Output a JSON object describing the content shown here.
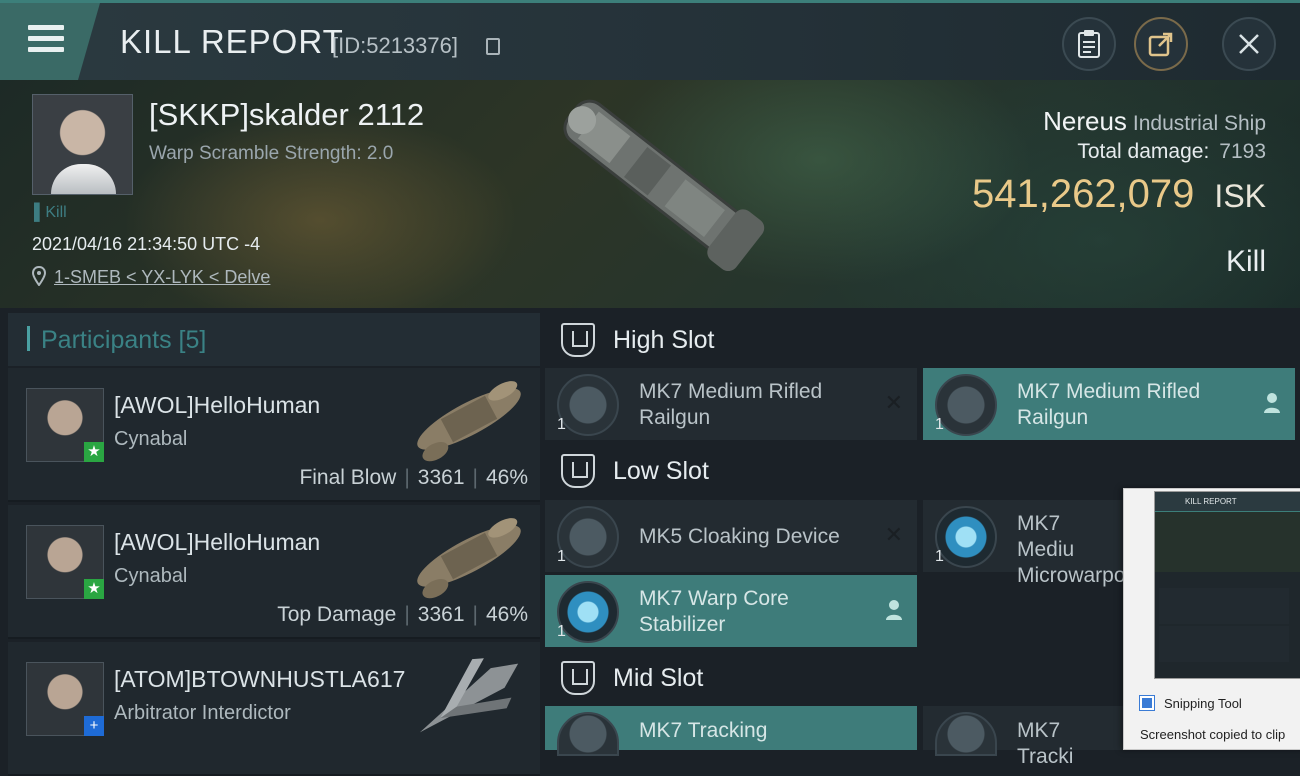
{
  "header": {
    "title": "KILL REPORT",
    "report_id": "[ID:5213376]"
  },
  "victim": {
    "name": "[SKKP]skalder 2112",
    "warp_scramble": "Warp Scramble Strength: 2.0",
    "kill_tag": "Kill",
    "timestamp": "2021/04/16 21:34:50 UTC -4",
    "location": "1-SMEB < YX-LYK < Delve",
    "ship_name": "Nereus",
    "ship_class": "Industrial Ship",
    "total_damage_label": "Total damage:",
    "total_damage_value": "7193",
    "isk_value": "541,262,079",
    "isk_unit": "ISK",
    "result": "Kill"
  },
  "participants": {
    "title": "Participants [5]",
    "rows": [
      {
        "name": "[AWOL]HelloHuman",
        "ship": "Cynabal",
        "role": "Final Blow",
        "damage": "3361",
        "percent": "46%"
      },
      {
        "name": "[AWOL]HelloHuman",
        "ship": "Cynabal",
        "role": "Top Damage",
        "damage": "3361",
        "percent": "46%"
      },
      {
        "name": "[ATOM]BTOWNHUSTLA617",
        "ship": "Arbitrator Interdictor"
      }
    ]
  },
  "slots": {
    "high": {
      "title": "High Slot",
      "modules": [
        {
          "name": "MK7 Medium Rifled Railgun",
          "qty": "1"
        },
        {
          "name": "MK7 Medium Rifled Railgun",
          "qty": "1"
        }
      ]
    },
    "low": {
      "title": "Low Slot",
      "modules": [
        {
          "name": "MK5 Cloaking Device",
          "qty": "1"
        },
        {
          "name": "MK7 Mediu Microwarpo",
          "qty": "1"
        },
        {
          "name": "MK7 Warp Core Stabilizer",
          "qty": "1"
        }
      ]
    },
    "mid": {
      "title": "Mid Slot",
      "modules": [
        {
          "name": "MK7 Tracking",
          "qty": ""
        },
        {
          "name": "MK7 Tracki",
          "qty": ""
        }
      ]
    }
  },
  "overlay": {
    "thumb_title": "KILL REPORT",
    "app_name": "Snipping Tool",
    "message": "Screenshot copied to clip"
  },
  "icons": {
    "menu": "hamburger-icon",
    "report": "clipboard-icon",
    "share": "share-icon",
    "close": "close-icon",
    "location": "map-pin-icon",
    "copy": "copy-icon",
    "slot": "slot-icon",
    "remove": "x-mark-icon",
    "fitted": "person-icon"
  },
  "colors": {
    "accent": "#3e7c7a",
    "isk": "#e9c989",
    "badge_green": "#2aa642",
    "badge_blue": "#1e6bd6"
  }
}
